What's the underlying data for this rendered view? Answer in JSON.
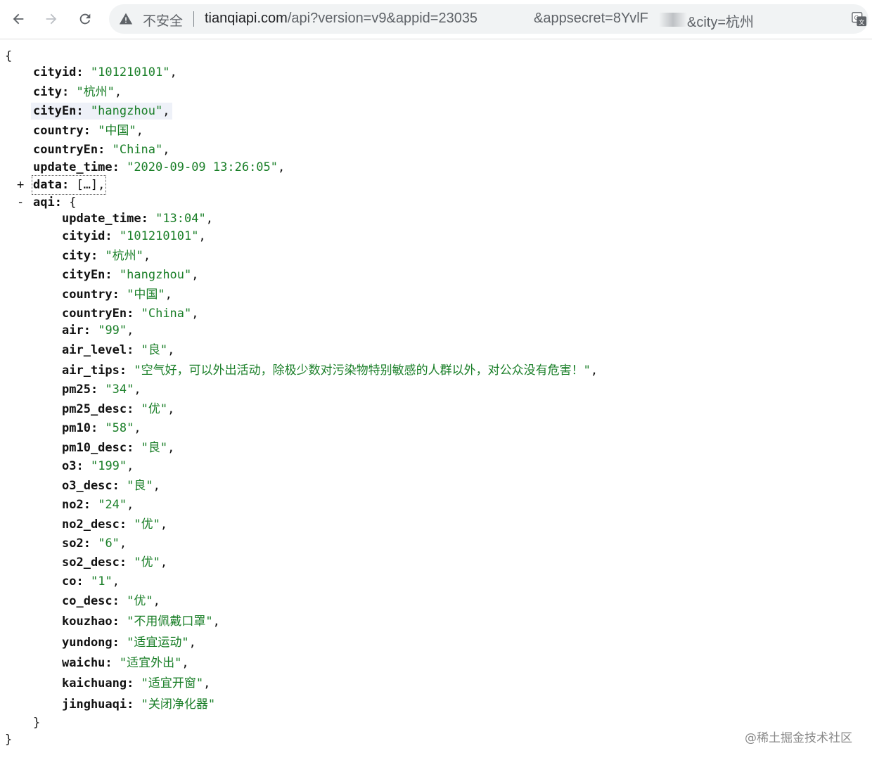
{
  "browser": {
    "security_label": "不安全",
    "url_domain": "tianqiapi.com",
    "url_part1_rest": "/api?version=v9&appid=23035",
    "url_part2": "&appsecret=8YvlF",
    "url_part3": "&city=杭州"
  },
  "json": {
    "open_brace": "{",
    "close_brace": "}",
    "cityid": "\"101210101\"",
    "city": "\"杭州\"",
    "cityEn": "\"hangzhou\"",
    "country": "\"中国\"",
    "countryEn": "\"China\"",
    "update_time": "\"2020-09-09 13:26:05\"",
    "data_collapsed": "[…]",
    "aqi": {
      "update_time": "\"13:04\"",
      "cityid": "\"101210101\"",
      "city": "\"杭州\"",
      "cityEn": "\"hangzhou\"",
      "country": "\"中国\"",
      "countryEn": "\"China\"",
      "air": "\"99\"",
      "air_level": "\"良\"",
      "air_tips": "\"空气好，可以外出活动，除极少数对污染物特别敏感的人群以外，对公众没有危害！\"",
      "pm25": "\"34\"",
      "pm25_desc": "\"优\"",
      "pm10": "\"58\"",
      "pm10_desc": "\"良\"",
      "o3": "\"199\"",
      "o3_desc": "\"良\"",
      "no2": "\"24\"",
      "no2_desc": "\"优\"",
      "so2": "\"6\"",
      "so2_desc": "\"优\"",
      "co": "\"1\"",
      "co_desc": "\"优\"",
      "kouzhao": "\"不用佩戴口罩\"",
      "yundong": "\"适宜运动\"",
      "waichu": "\"适宜外出\"",
      "kaichuang": "\"适宜开窗\"",
      "jinghuaqi": "\"关闭净化器\""
    }
  },
  "keys": {
    "cityid": "cityid:",
    "city": "city:",
    "cityEn": "cityEn:",
    "country": "country:",
    "countryEn": "countryEn:",
    "update_time": "update_time:",
    "data": "data:",
    "aqi": "aqi:",
    "air": "air:",
    "air_level": "air_level:",
    "air_tips": "air_tips:",
    "pm25": "pm25:",
    "pm25_desc": "pm25_desc:",
    "pm10": "pm10:",
    "pm10_desc": "pm10_desc:",
    "o3": "o3:",
    "o3_desc": "o3_desc:",
    "no2": "no2:",
    "no2_desc": "no2_desc:",
    "so2": "so2:",
    "so2_desc": "so2_desc:",
    "co": "co:",
    "co_desc": "co_desc:",
    "kouzhao": "kouzhao:",
    "yundong": "yundong:",
    "waichu": "waichu:",
    "kaichuang": "kaichuang:",
    "jinghuaqi": "jinghuaqi:"
  },
  "toggles": {
    "expand": "+",
    "collapse": "-"
  },
  "watermark": "@稀土掘金技术社区",
  "icons": [
    "back-arrow-icon",
    "forward-arrow-icon",
    "reload-icon",
    "warning-icon",
    "translate-icon"
  ]
}
